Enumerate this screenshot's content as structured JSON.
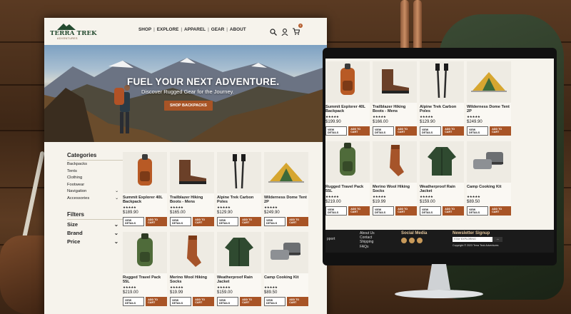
{
  "site": {
    "logo_name": "TERRA TREK",
    "logo_sub": "ADVENTURES",
    "cart_count": "0"
  },
  "nav": {
    "items": [
      "SHOP",
      "EXPLORE",
      "APPAREL",
      "GEAR",
      "ABOUT"
    ]
  },
  "hero": {
    "title": "FUEL YOUR NEXT ADVENTURE.",
    "subtitle": "Discover Rugged Gear for the Journey.",
    "cta": "SHOP BACKPACKS"
  },
  "sidebar": {
    "categories_title": "Categories",
    "categories": [
      "Backpacks",
      "Tents",
      "Clothing",
      "Footwear",
      "Navigation",
      "Accessories"
    ],
    "filters_title": "Filters",
    "filters": [
      "Size",
      "Brand",
      "Price"
    ]
  },
  "products": [
    {
      "name": "Summit Explorer 40L Backpack",
      "stars": "★★★★★",
      "price": "$189.90",
      "icon": "backpack-icon"
    },
    {
      "name": "Trailblazer Hiking Boots - Mens",
      "stars": "★★★★★",
      "price": "$165.00",
      "icon": "boots-icon"
    },
    {
      "name": "Alpine Trek Carbon Poles",
      "stars": "★★★★★",
      "price": "$129.90",
      "icon": "poles-icon"
    },
    {
      "name": "Wilderness Dome Tent 2P",
      "stars": "★★★★★",
      "price": "$249.90",
      "icon": "tent-icon"
    },
    {
      "name": "Rugged Travel Pack 55L",
      "stars": "★★★★★",
      "price": "$219.00",
      "icon": "travel-pack-icon"
    },
    {
      "name": "Merino Wool Hiking Socks",
      "stars": "★★★★★",
      "price": "$19.99",
      "icon": "socks-icon"
    },
    {
      "name": "Weatherproof Rain Jacket",
      "stars": "★★★★★",
      "price": "$159.00",
      "icon": "jacket-icon"
    },
    {
      "name": "Camp Cooking Kit",
      "stars": "★★★★★",
      "price": "$89.50",
      "icon": "cookware-icon"
    }
  ],
  "monitor_products": [
    {
      "name": "Summit Explorer 40L Backpack",
      "stars": "★★★★★",
      "price": "$199.90"
    },
    {
      "name": "Trailblazer Hiking Boots - Mens",
      "stars": "★★★★★",
      "price": "$166.00"
    },
    {
      "name": "Alpine Trek Carbon Poles",
      "stars": "★★★★★",
      "price": "$129.90"
    },
    {
      "name": "Wilderness Dome Tent 2P",
      "stars": "★★★★★",
      "price": "$249.90"
    },
    {
      "name": "Rugged Travel Pack 55L",
      "stars": "★★★★★",
      "price": "$219.00"
    },
    {
      "name": "Merino Wool Hiking Socks",
      "stars": "★★★★★",
      "price": "$19.99"
    },
    {
      "name": "Weatherproof Rain Jacket",
      "stars": "★★★★★",
      "price": "$159.00"
    },
    {
      "name": "Camp Cooking Kit",
      "stars": "★★★★★",
      "price": "$89.50"
    }
  ],
  "buttons": {
    "view": "VIEW DETAILS",
    "add": "ADD TO CART"
  },
  "footer": {
    "links": [
      "About Us",
      "Contact",
      "Shipping",
      "FAQs"
    ],
    "left_fragment": "pport",
    "social_title": "Social Media",
    "newsletter_title": "Newsletter Signup",
    "newsletter_placeholder": "STAY EXPLORING",
    "copyright": "Copyright © 2023 Terra Teck Adventures"
  },
  "colors": {
    "accent": "#a85426",
    "brand_green": "#234a2f",
    "paper": "#f6f3ec"
  }
}
